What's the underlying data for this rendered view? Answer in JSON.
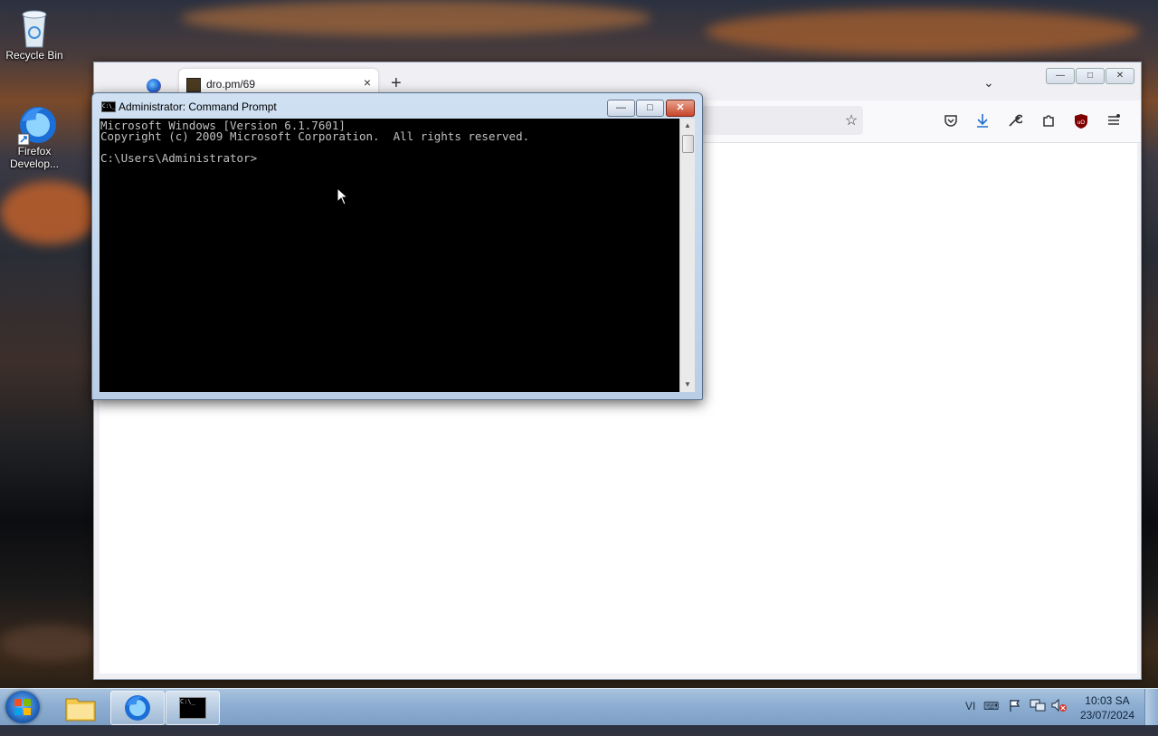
{
  "desktop": {
    "icons": [
      {
        "label": "Recycle Bin"
      },
      {
        "label": "Firefox Develop..."
      }
    ]
  },
  "firefox": {
    "tab_title": "dro.pm/69",
    "tab_close": "×",
    "new_tab": "+",
    "list_all_tabs": "⌄",
    "controls": {
      "minimize": "—",
      "maximize": "□",
      "close": "✕"
    }
  },
  "cmd": {
    "title": "Administrator: Command Prompt",
    "icon_text": "C:\\_",
    "console_text": "Microsoft Windows [Version 6.1.7601]\nCopyright (c) 2009 Microsoft Corporation.  All rights reserved.\n\nC:\\Users\\Administrator>",
    "controls": {
      "minimize": "—",
      "maximize": "□",
      "close": "✕"
    }
  },
  "taskbar": {
    "language": "VI",
    "time": "10:03 SA",
    "date": "23/07/2024"
  }
}
